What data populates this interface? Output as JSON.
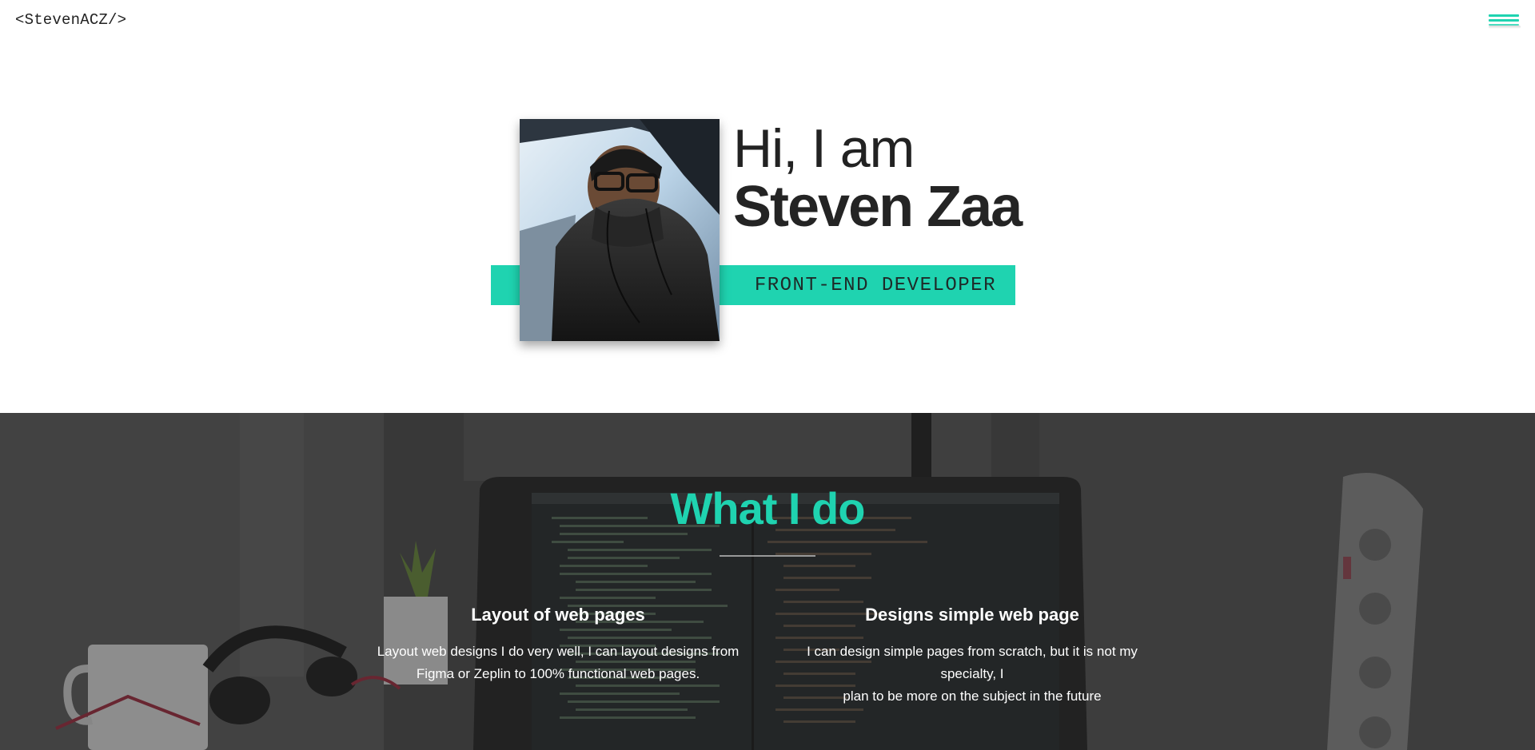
{
  "header": {
    "logo": "<StevenACZ/>",
    "menu_icon": "hamburger-menu-icon",
    "accent": "#1fd3b0"
  },
  "hero": {
    "greeting": "Hi, I am",
    "name": "Steven Zaa",
    "role": "FRONT-END DEVELOPER",
    "photo_icon": "profile-photo"
  },
  "services": {
    "title": "What I do",
    "items": [
      {
        "title": "Layout of web pages",
        "text_line1": "Layout web designs I do very well, I can layout designs from",
        "text_line2": "Figma or Zeplin to 100% functional web pages."
      },
      {
        "title": "Designs simple web page",
        "text_line1": "I can design simple pages from scratch, but it is not my specialty, I",
        "text_line2": "plan to be more on the subject in the future"
      }
    ]
  }
}
